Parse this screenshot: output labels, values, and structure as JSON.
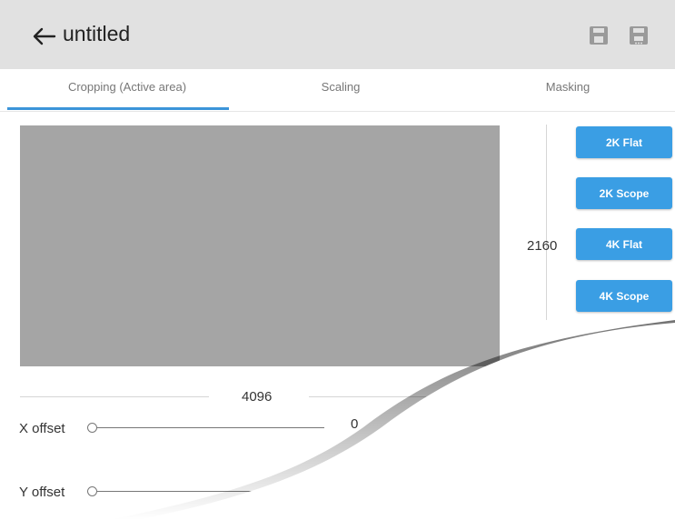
{
  "header": {
    "back_icon": "arrow-left-icon",
    "title": "untitled",
    "save_icon": "floppy-disk-icon",
    "save_as_icon": "floppy-disk-ellipsis-icon"
  },
  "tabs": [
    {
      "label": "Cropping (Active area)",
      "active": true
    },
    {
      "label": "Scaling",
      "active": false
    },
    {
      "label": "Masking",
      "active": false
    }
  ],
  "crop": {
    "height_value": "2160",
    "width_value": "4096",
    "presets": [
      "2K Flat",
      "2K Scope",
      "4K Flat",
      "4K Scope"
    ]
  },
  "offsets": {
    "x_label": "X offset",
    "x_value": "0",
    "y_label": "Y offset"
  },
  "colors": {
    "accent": "#3a9ee4",
    "header_bg": "#e1e1e1",
    "preview_bg": "#a5a5a5"
  }
}
